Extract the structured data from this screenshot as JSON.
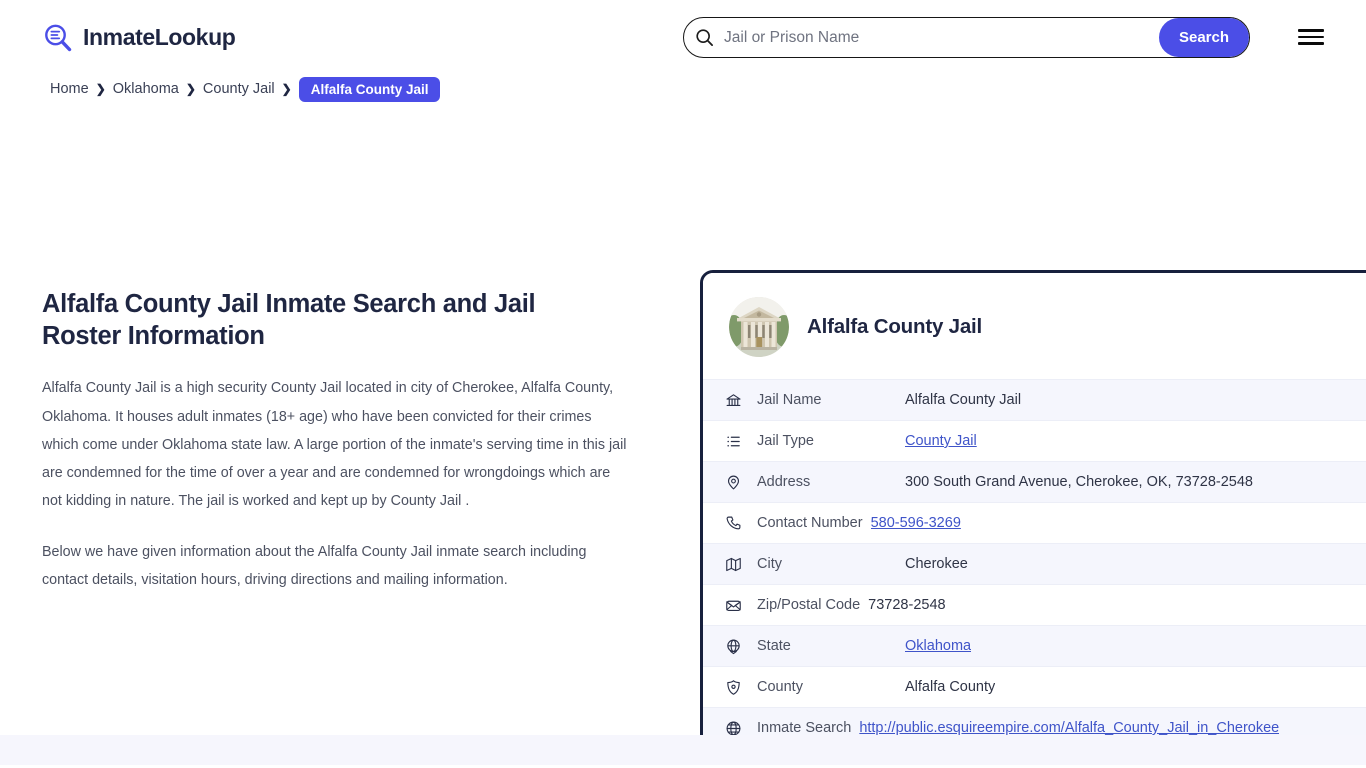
{
  "header": {
    "brand_name": "InmateLookup",
    "brand_icon": "magnifier-list-icon",
    "menu_icon": "hamburger-menu-icon",
    "accent_color": "#4b4ee7",
    "dark_color": "#1f2642"
  },
  "search": {
    "icon": "search-icon",
    "placeholder": "Jail or Prison Name",
    "value": "",
    "button_label": "Search"
  },
  "breadcrumb": {
    "separator": "❯",
    "items": [
      {
        "label": "Home",
        "current": false
      },
      {
        "label": "Oklahoma",
        "current": false
      },
      {
        "label": "County Jail",
        "current": false
      },
      {
        "label": "Alfalfa County Jail",
        "current": true
      }
    ]
  },
  "main": {
    "title": "Alfalfa County Jail Inmate Search and Jail Roster Information",
    "paragraphs": [
      "Alfalfa County Jail is a high security County Jail located in city of Cherokee, Alfalfa County, Oklahoma. It houses adult inmates (18+ age) who have been convicted for their crimes which come under Oklahoma state law. A large portion of the inmate's serving time in this jail are condemned for the time of over a year and are condemned for wrongdoings which are not kidding in nature. The jail is worked and kept up by County Jail .",
      "Below we have given information about the Alfalfa County Jail inmate search including contact details, visitation hours, driving directions and mailing information."
    ]
  },
  "card": {
    "avatar_icon": "courthouse-photo",
    "title": "Alfalfa County Jail",
    "border_color": "#17203d",
    "rows": [
      {
        "icon": "bank-icon",
        "label": "Jail Name",
        "value": "Alfalfa County Jail",
        "link": false,
        "stripe": "alt"
      },
      {
        "icon": "list-icon",
        "label": "Jail Type",
        "value": "County Jail",
        "link": true,
        "stripe": "plain"
      },
      {
        "icon": "map-pin-icon",
        "label": "Address",
        "value": "300 South Grand Avenue, Cherokee, OK, 73728-2548",
        "link": false,
        "stripe": "alt"
      },
      {
        "icon": "phone-icon",
        "label": "Contact Number",
        "value": "580-596-3269",
        "link": true,
        "stripe": "plain"
      },
      {
        "icon": "map-icon",
        "label": "City",
        "value": "Cherokee",
        "link": false,
        "stripe": "alt"
      },
      {
        "icon": "envelope-icon",
        "label": "Zip/Postal Code",
        "value": "73728-2548",
        "link": false,
        "stripe": "plain"
      },
      {
        "icon": "globe-badge-icon",
        "label": "State",
        "value": "Oklahoma",
        "link": true,
        "stripe": "alt"
      },
      {
        "icon": "shield-icon",
        "label": "County",
        "value": "Alfalfa County",
        "link": false,
        "stripe": "plain"
      },
      {
        "icon": "globe-icon",
        "label": "Inmate Search",
        "value": "http://public.esquireempire.com/Alfalfa_County_Jail_in_Cherokee",
        "link": true,
        "stripe": "alt"
      }
    ]
  }
}
